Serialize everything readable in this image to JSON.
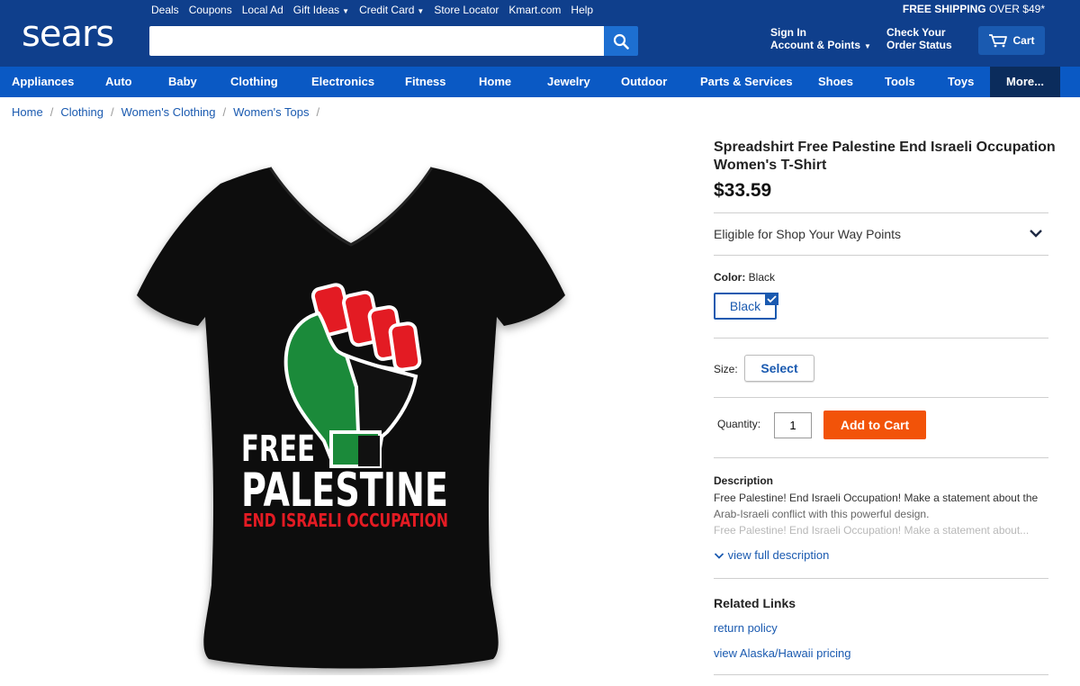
{
  "header": {
    "logo": "sears",
    "top_links": [
      "Deals",
      "Coupons",
      "Local Ad",
      "Gift Ideas",
      "Credit Card",
      "Store Locator",
      "Kmart.com",
      "Help"
    ],
    "free_shipping_bold": "FREE SHIPPING",
    "free_shipping_rest": "OVER $49*",
    "search_placeholder": "",
    "sign_in_line1": "Sign In",
    "sign_in_line2": "Account & Points",
    "check_line1": "Check Your",
    "check_line2": "Order Status",
    "cart_label": "Cart"
  },
  "nav": {
    "items": [
      "Appliances",
      "Auto",
      "Baby",
      "Clothing",
      "Electronics",
      "Fitness",
      "Home",
      "Jewelry",
      "Outdoor",
      "Parts & Services",
      "Shoes",
      "Tools",
      "Toys"
    ],
    "more": "More..."
  },
  "breadcrumb": [
    "Home",
    "Clothing",
    "Women's Clothing",
    "Women's Tops"
  ],
  "breadcrumb_sep": "/",
  "product": {
    "image_text_1": "FREE",
    "image_text_2": "PALESTINE",
    "image_text_3": "END ISRAELI OCCUPATION",
    "title": "Spreadshirt Free Palestine End Israeli Occupation Women's T-Shirt",
    "price": "$33.59",
    "points_label": "Eligible for Shop Your Way Points",
    "color_label": "Color:",
    "color_value": "Black",
    "swatch_label": "Black",
    "size_label": "Size:",
    "size_button": "Select",
    "quantity_label": "Quantity:",
    "quantity_value": "1",
    "add_to_cart": "Add to Cart",
    "description_heading": "Description",
    "description_line1": "Free Palestine! End Israeli Occupation! Make a statement about the",
    "description_line2": "Arab-Israeli conflict with this powerful design.",
    "description_line3": "Free Palestine! End Israeli Occupation! Make a statement about...",
    "view_full": "view full description",
    "related_heading": "Related Links",
    "related_links": [
      "return policy",
      "view Alaska/Hawaii pricing"
    ]
  },
  "colors": {
    "header_bg": "#0f3f8c",
    "nav_bg": "#0a59c4",
    "link": "#1a5ab0",
    "add_to_cart": "#f25309"
  }
}
